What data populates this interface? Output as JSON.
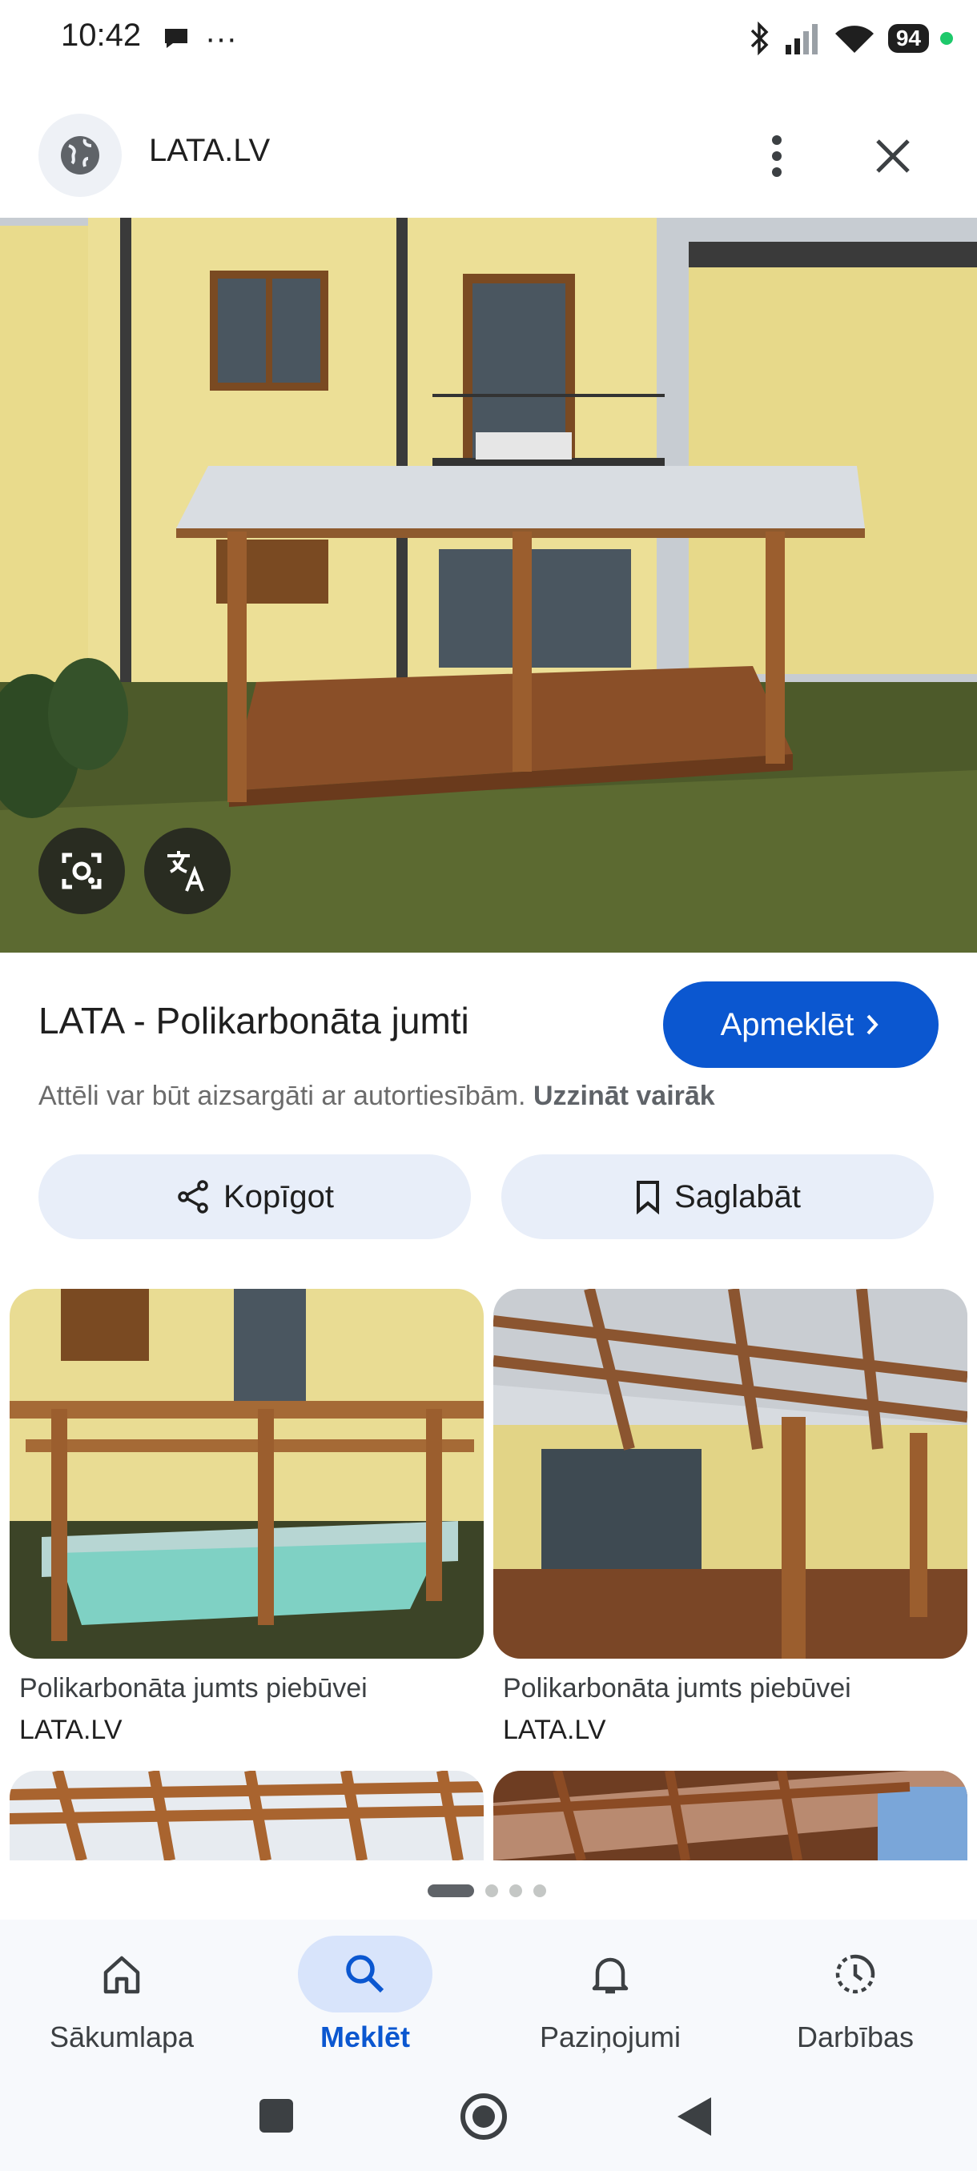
{
  "status_bar": {
    "time": "10:42",
    "battery": "94"
  },
  "header": {
    "site_name": "LATA.LV"
  },
  "result": {
    "title": "LATA - Polikarbonāta jumti",
    "visit_label": "Apmeklēt",
    "copyright_text": "Attēli var būt aizsargāti ar autortiesībām.",
    "learn_more": "Uzzināt vairāk",
    "share_label": "Kopīgot",
    "save_label": "Saglabāt"
  },
  "related": [
    {
      "caption": "Polikarbonāta jumts piebūvei",
      "source": "LATA.LV"
    },
    {
      "caption": "Polikarbonāta jumts piebūvei",
      "source": "LATA.LV"
    }
  ],
  "bottom_nav": [
    {
      "label": "Sākumlapa",
      "icon": "home-icon"
    },
    {
      "label": "Meklēt",
      "icon": "search-icon"
    },
    {
      "label": "Paziņojumi",
      "icon": "bell-icon"
    },
    {
      "label": "Darbības",
      "icon": "activity-icon"
    }
  ],
  "colors": {
    "accent": "#0b57d0",
    "pill_bg": "#e8eef9"
  }
}
